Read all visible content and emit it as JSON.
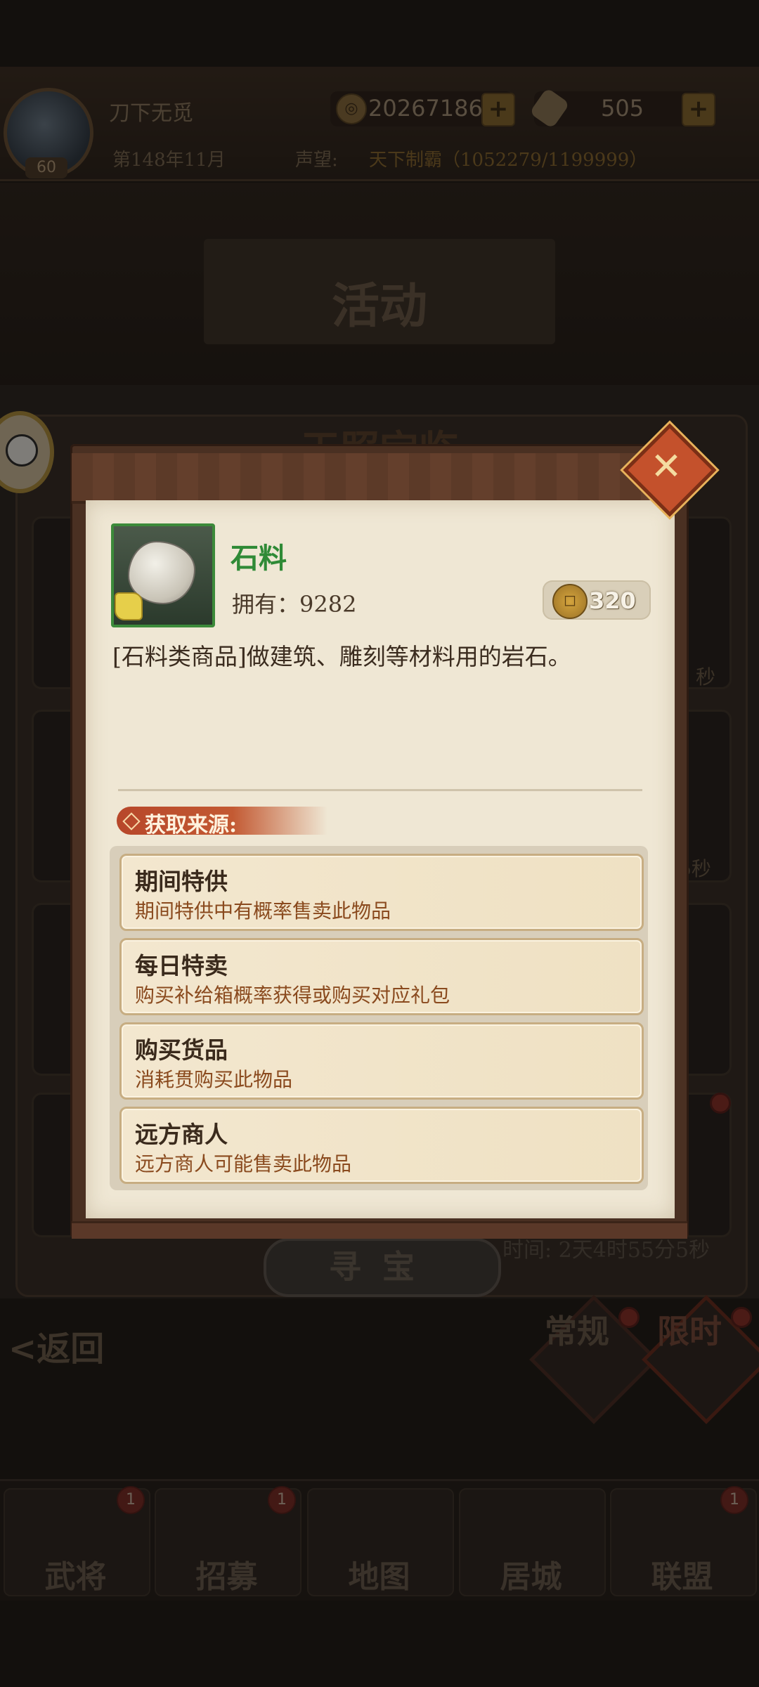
{
  "header": {
    "player_name": "刀下无觅",
    "level": "60",
    "coins": "20267186",
    "scrolls": "505",
    "date": "第148年11月",
    "fame_label": "声望:",
    "fame_value": "天下制霸（1052279/1199999）"
  },
  "scene": {
    "hall_title": "活动",
    "event_header": "天照宝临",
    "side_timer_1": "秒",
    "side_timer_2": "5秒",
    "treasure_button": "寻宝",
    "timer": "时间: 2天4时55分5秒",
    "back_label": "返回",
    "mode_regular": "常规",
    "mode_limited": "限时"
  },
  "bottom_nav": [
    {
      "label": "武将",
      "badge": "1"
    },
    {
      "label": "招募",
      "badge": "1"
    },
    {
      "label": "地图",
      "badge": ""
    },
    {
      "label": "居城",
      "badge": ""
    },
    {
      "label": "联盟",
      "badge": "1"
    }
  ],
  "modal": {
    "close_icon": "close-x",
    "item": {
      "name": "石料",
      "own_label": "拥有：9282",
      "price": "320",
      "description": "[石料类商品]做建筑、雕刻等材料用的岩石。",
      "icon": "stone-icon"
    },
    "source_title": "获取来源:",
    "sources": [
      {
        "name": "期间特供",
        "desc": "期间特供中有概率售卖此物品"
      },
      {
        "name": "每日特卖",
        "desc": "购买补给箱概率获得或购买对应礼包"
      },
      {
        "name": "购买货品",
        "desc": "消耗贯购买此物品"
      },
      {
        "name": "远方商人",
        "desc": "远方商人可能售卖此物品"
      }
    ]
  },
  "colors": {
    "item_name": "#2f8a36",
    "source_desc": "#8a4a1e",
    "ribbon": "#c35a33",
    "paper": "#efe7d4"
  }
}
